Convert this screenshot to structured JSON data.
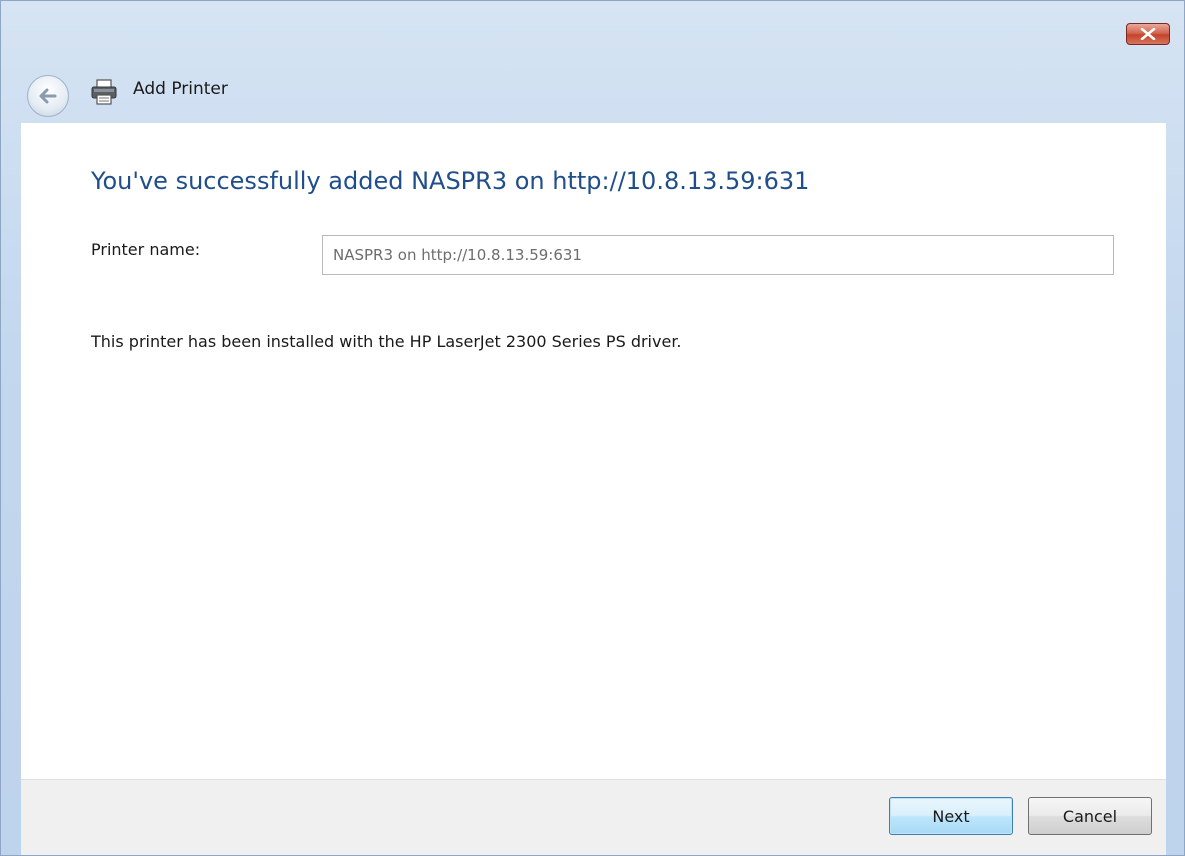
{
  "window": {
    "title": "Add Printer",
    "close_icon": "close-icon",
    "back_icon": "back-arrow-icon",
    "title_icon": "printer-icon"
  },
  "content": {
    "heading": "You've successfully added NASPR3 on http://10.8.13.59:631",
    "printer_name_label": "Printer name:",
    "printer_name_value": "NASPR3 on http://10.8.13.59:631",
    "driver_message": "This printer has been installed with the HP LaserJet 2300 Series PS driver."
  },
  "footer": {
    "next_label": "Next",
    "cancel_label": "Cancel"
  },
  "colors": {
    "heading": "#1f4e8b",
    "title_bar": "#c3d7ee",
    "close_button": "#c4432b",
    "footer_bg": "#f0f0f0"
  }
}
